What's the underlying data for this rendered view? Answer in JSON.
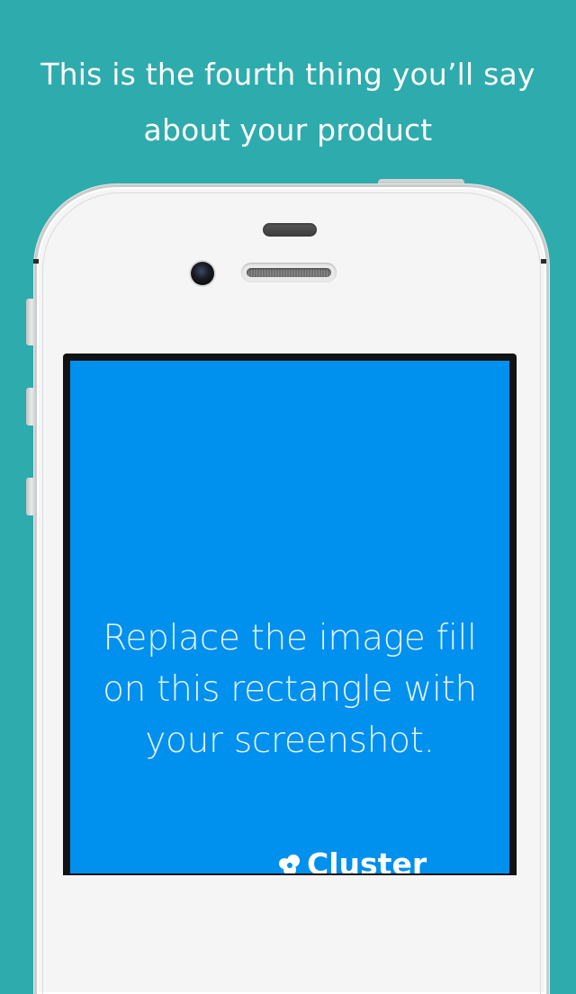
{
  "headline": {
    "line1": "This is the fourth thing you’ll say",
    "line2": "about your product"
  },
  "screen": {
    "background_color": "#0090ee",
    "line1": "Replace the image fill",
    "line2": "on this rectangle with",
    "line3": "your screenshot."
  },
  "brand": {
    "name": "Cluster",
    "icon": "cluster-logo-icon"
  },
  "colors": {
    "background": "#2eabad",
    "phone_body": "#f5f5f5",
    "screen": "#0090ee"
  }
}
